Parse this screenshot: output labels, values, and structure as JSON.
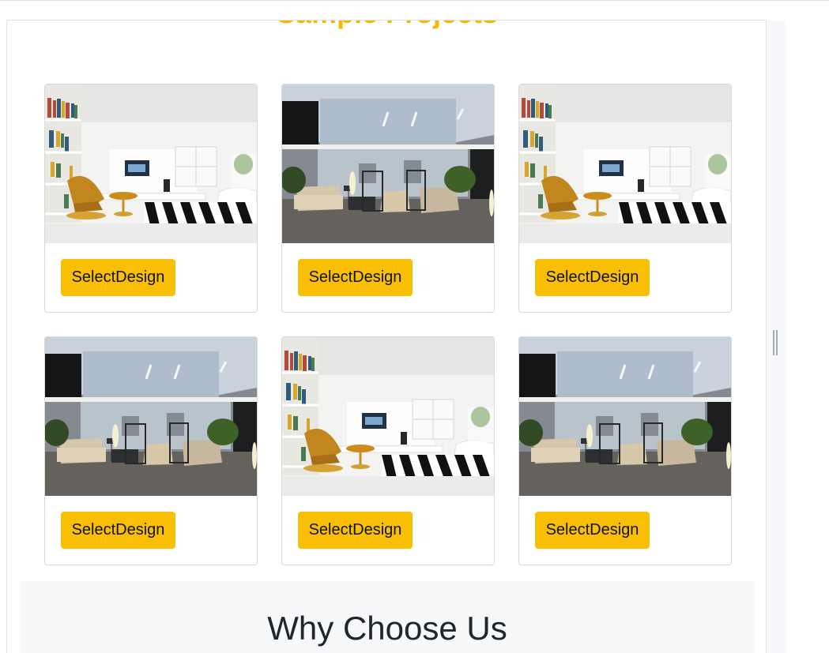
{
  "section": {
    "top_heading": "Sample Projects"
  },
  "designs": [
    {
      "button_label": "SelectDesign",
      "image_icon": "white-living-room-image"
    },
    {
      "button_label": "SelectDesign",
      "image_icon": "modern-lounge-image"
    },
    {
      "button_label": "SelectDesign",
      "image_icon": "white-living-room-image"
    },
    {
      "button_label": "SelectDesign",
      "image_icon": "modern-lounge-image"
    },
    {
      "button_label": "SelectDesign",
      "image_icon": "white-living-room-image"
    },
    {
      "button_label": "SelectDesign",
      "image_icon": "modern-lounge-image"
    }
  ],
  "why_section": {
    "title": "Why Choose Us"
  },
  "colors": {
    "accent": "#f9bf05",
    "heading_text": "#22252a",
    "section_bg": "#f7f8fa"
  }
}
